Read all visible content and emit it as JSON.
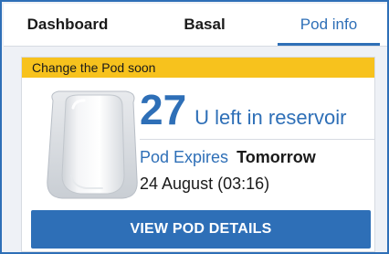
{
  "tabs": [
    {
      "label": "Dashboard",
      "active": false
    },
    {
      "label": "Basal",
      "active": false
    },
    {
      "label": "Pod info",
      "active": true
    }
  ],
  "pod_card": {
    "alert_text": "Change the Pod soon",
    "pod_image_icon": "pod-device-icon",
    "reservoir_value": "27",
    "reservoir_label": "U left in reservoir",
    "expires_label": "Pod Expires",
    "expires_value": "Tomorrow",
    "expiry_date": "24 August (03:16)",
    "button_label": "VIEW POD DETAILS"
  },
  "colors": {
    "accent": "#2e6fb7",
    "alert": "#f7c21d",
    "text": "#1a1a1a",
    "background": "#eef1f6"
  }
}
